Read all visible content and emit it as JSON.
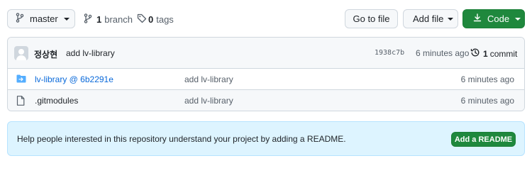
{
  "toolbar": {
    "branch_select": "master",
    "branch_count": "1",
    "branch_label": "branch",
    "tag_count": "0",
    "tag_label": "tags",
    "goto_file_label": "Go to file",
    "add_file_label": "Add file",
    "code_label": "Code"
  },
  "commit": {
    "author": "정상현",
    "message": "add lv-library",
    "sha": "1938c7b",
    "time": "6 minutes ago",
    "count": "1",
    "count_label": "commit"
  },
  "files": [
    {
      "name": "lv-library @ 6b2291e",
      "type": "submodule",
      "message": "add lv-library",
      "time": "6 minutes ago"
    },
    {
      "name": ".gitmodules",
      "type": "file",
      "message": "add lv-library",
      "time": "6 minutes ago"
    }
  ],
  "readme_banner": {
    "text": "Help people interested in this repository understand your project by adding a README.",
    "button_label": "Add a README"
  },
  "colors": {
    "primary_green": "#1f883d",
    "link_blue": "#0969da",
    "banner_bg": "#ddf4ff",
    "muted": "#57606a"
  },
  "icons": [
    "git-branch-icon",
    "tag-icon",
    "download-icon",
    "history-icon",
    "submodule-folder-icon",
    "file-icon",
    "avatar-icon"
  ]
}
